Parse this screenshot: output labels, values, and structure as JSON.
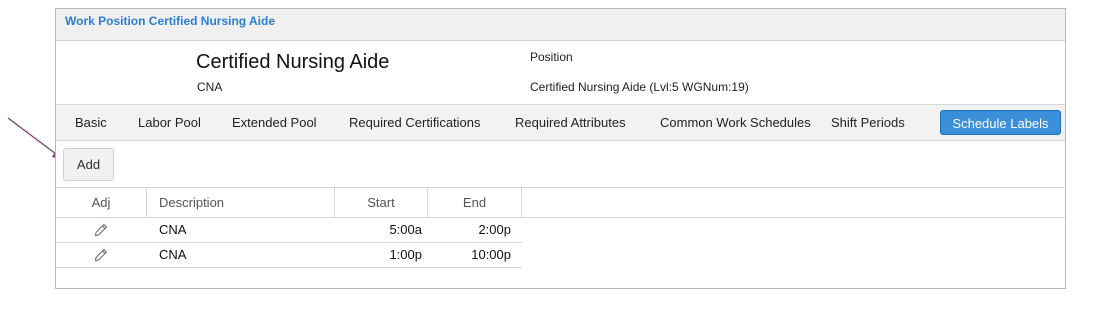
{
  "panel": {
    "title": "Work Position Certified Nursing Aide"
  },
  "position": {
    "name": "Certified Nursing Aide",
    "code": "CNA",
    "type_label": "Position",
    "detail": "Certified Nursing Aide (Lvl:5 WGNum:19)"
  },
  "tabs": [
    {
      "label": "Basic",
      "active": false
    },
    {
      "label": "Labor Pool",
      "active": false
    },
    {
      "label": "Extended Pool",
      "active": false
    },
    {
      "label": "Required Certifications",
      "active": false
    },
    {
      "label": "Required Attributes",
      "active": false
    },
    {
      "label": "Common Work Schedules",
      "active": false
    },
    {
      "label": "Shift Periods",
      "active": false
    },
    {
      "label": "Schedule Labels",
      "active": true
    }
  ],
  "toolbar": {
    "add_label": "Add"
  },
  "grid": {
    "columns": {
      "adj": "Adj",
      "description": "Description",
      "start": "Start",
      "end": "End"
    },
    "rows": [
      {
        "description": "CNA",
        "start": "5:00a",
        "end": "2:00p",
        "edit_icon": "pencil-icon"
      },
      {
        "description": "CNA",
        "start": "1:00p",
        "end": "10:00p",
        "edit_icon": "pencil-icon"
      }
    ]
  },
  "colors": {
    "header_title": "#2a7fd4",
    "active_tab": "#3a8fd8",
    "annotation_arrow": "#7a3a6a"
  }
}
